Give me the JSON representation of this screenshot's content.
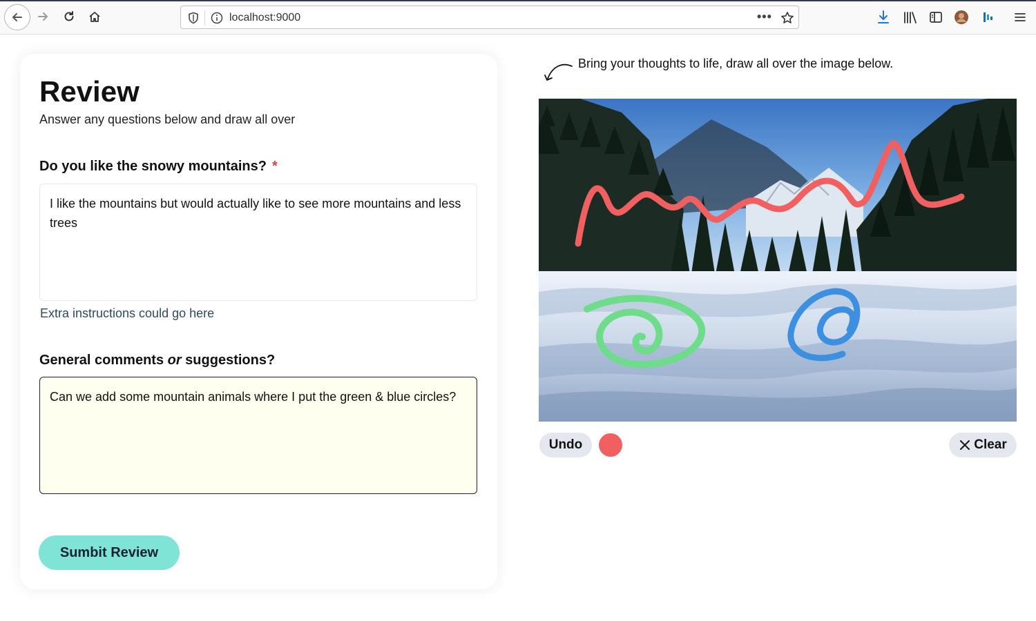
{
  "browser": {
    "url": "localhost:9000",
    "more_label": "•••"
  },
  "form": {
    "title": "Review",
    "subtitle": "Answer any questions below and draw all over",
    "question1": {
      "label": "Do you like the snowy mountains?",
      "required_mark": "*",
      "value": "I like the mountains but would actually like to see more mountains and less trees",
      "hint": "Extra instructions could go here"
    },
    "question2": {
      "label_prefix": "General comments ",
      "label_emphasis": "or",
      "label_suffix": " suggestions?",
      "value": "Can we add some mountain animals where I put the green & blue circles?"
    },
    "submit_label": "Sumbit Review"
  },
  "drawing": {
    "prompt": "Bring your thoughts to life, draw all over the image below.",
    "undo_label": "Undo",
    "clear_label": "Clear",
    "selected_color": "#f06060",
    "stroke_colors": {
      "red": "#f06060",
      "green": "#6fdc8c",
      "blue": "#3d8fe0"
    }
  },
  "colors": {
    "submit_bg": "#7fe3d6",
    "button_bg": "#e4e8ee",
    "required": "#e53e3e",
    "hint_text": "#2c4a66",
    "active_textarea_bg": "#fffff0"
  }
}
